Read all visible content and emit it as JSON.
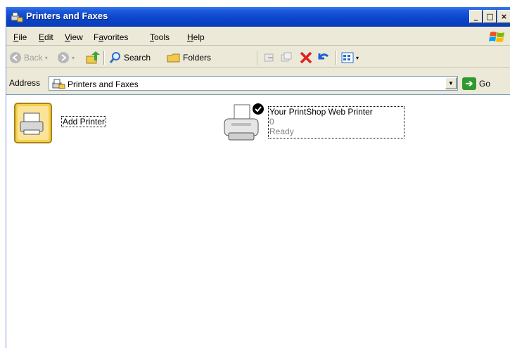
{
  "window": {
    "title": "Printers and Faxes"
  },
  "caption_buttons": {
    "minimize": "_",
    "maximize": "□",
    "close": "×"
  },
  "menu": [
    {
      "pre": "",
      "u": "F",
      "post": "ile"
    },
    {
      "pre": "",
      "u": "E",
      "post": "dit"
    },
    {
      "pre": "",
      "u": "V",
      "post": "iew"
    },
    {
      "pre": "F",
      "u": "a",
      "post": "vorites"
    },
    {
      "pre": "",
      "u": "T",
      "post": "ools"
    },
    {
      "pre": "",
      "u": "H",
      "post": "elp"
    }
  ],
  "toolbar": {
    "back": "Back",
    "search": "Search",
    "folders": "Folders"
  },
  "address": {
    "label": "Address",
    "value": "Printers and Faxes",
    "go": "Go"
  },
  "items": {
    "add_printer": {
      "label": "Add Printer"
    },
    "printer": {
      "name": "Your PrintShop Web Printer",
      "documents": "0",
      "status": "Ready"
    }
  },
  "colors": {
    "titlebar": "#0b46cc",
    "chrome": "#ece9d8",
    "go": "#2f9a2f",
    "delete": "#e02020"
  }
}
